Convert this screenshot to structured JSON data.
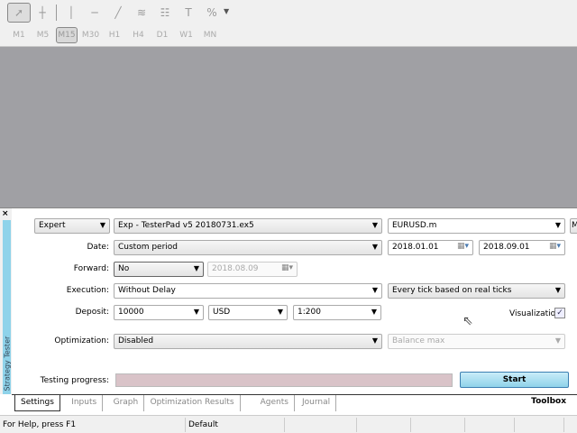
{
  "toolbar": {
    "tools": [
      {
        "name": "cursor",
        "glyph": "➚"
      },
      {
        "name": "crosshair",
        "glyph": "┼"
      },
      {
        "name": "vertical-line",
        "glyph": "│"
      },
      {
        "name": "horizontal-line",
        "glyph": "─"
      },
      {
        "name": "trend-line",
        "glyph": "╱"
      },
      {
        "name": "elliott-wave",
        "glyph": "≋"
      },
      {
        "name": "fibonacci",
        "glyph": "☷"
      },
      {
        "name": "text-label",
        "glyph": "T"
      },
      {
        "name": "shapes",
        "glyph": "%"
      }
    ],
    "timeframes": [
      "M1",
      "M5",
      "M15",
      "M30",
      "H1",
      "H4",
      "D1",
      "W1",
      "MN"
    ],
    "active_timeframe": "M15"
  },
  "tester": {
    "title": "Strategy Tester",
    "close": "×",
    "type": "Expert",
    "expert": "Exp - TesterPad v5 20180731.ex5",
    "symbol": "EURUSD.m",
    "symbol_btn": "M",
    "date_label": "Date:",
    "date_mode": "Custom period",
    "date_from": "2018.01.01",
    "date_to": "2018.09.01",
    "forward_label": "Forward:",
    "forward": "No",
    "forward_date": "2018.08.09",
    "execution_label": "Execution:",
    "execution": "Without Delay",
    "model": "Every tick based on real ticks",
    "deposit_label": "Deposit:",
    "deposit": "10000",
    "currency": "USD",
    "leverage": "1:200",
    "visualization_label": "Visualization",
    "visualization": true,
    "optimization_label": "Optimization:",
    "optimization": "Disabled",
    "criterion": "Balance max",
    "progress_label": "Testing progress:",
    "progress": 0,
    "start": "Start"
  },
  "tabs": [
    "Settings",
    "Inputs",
    "Graph",
    "Optimization Results",
    "Agents",
    "Journal"
  ],
  "toolbox": "Toolbox",
  "status": {
    "help": "For Help, press F1",
    "profile": "Default"
  }
}
